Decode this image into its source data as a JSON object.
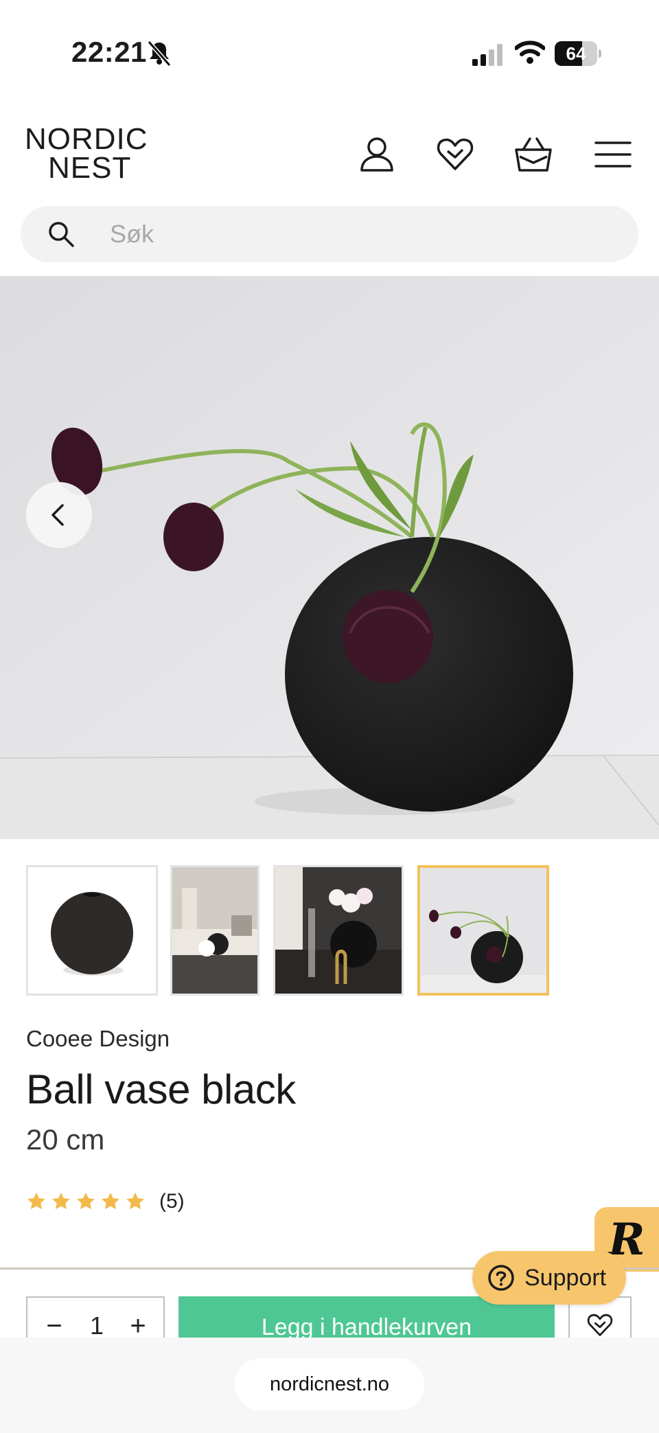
{
  "status_bar": {
    "time": "22:21",
    "battery_level": "64",
    "battery_fraction": 0.64
  },
  "header": {
    "logo_line1": "NORDIC",
    "logo_line2": "NEST",
    "icons": [
      "account-icon",
      "wishlist-icon",
      "cart-icon",
      "menu-icon"
    ]
  },
  "search": {
    "placeholder": "Søk"
  },
  "gallery": {
    "thumbnail_count": 4,
    "active_thumbnail": 4
  },
  "product": {
    "brand": "Cooee Design",
    "title": "Ball vase black",
    "size": "20 cm",
    "rating_stars": 5,
    "rating_count": "(5)"
  },
  "support": {
    "label": "Support"
  },
  "cart": {
    "minus_label": "−",
    "quantity": "1",
    "plus_label": "+",
    "add_label": "Legg i handlekurven"
  },
  "browser": {
    "url": "nordicnest.no"
  },
  "colors": {
    "add_button": "#4ec795",
    "accent_yellow": "#f7c66c",
    "star": "#f3b94a"
  }
}
